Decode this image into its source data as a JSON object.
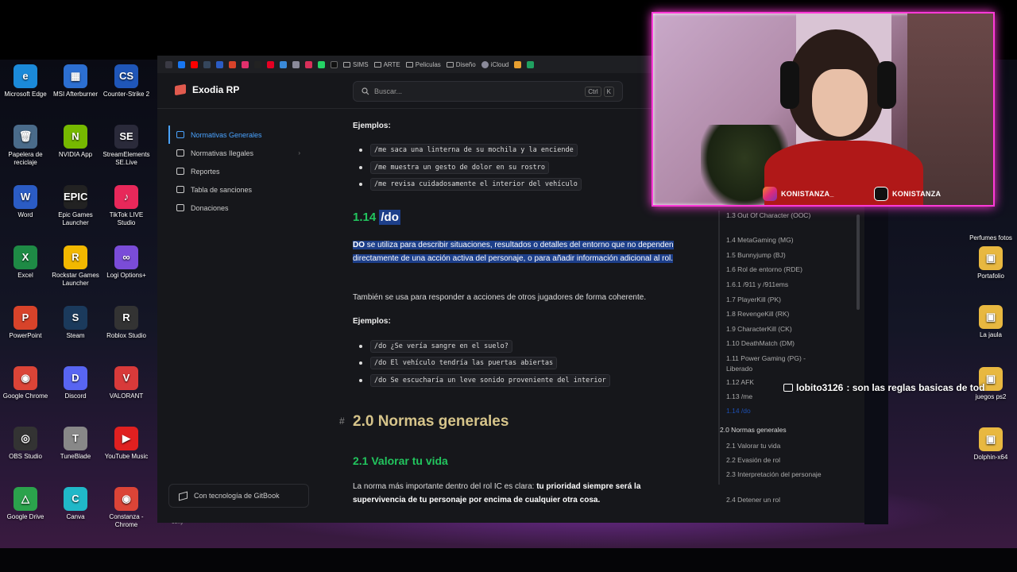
{
  "desktop": {
    "icons": [
      {
        "label": "Microsoft Edge",
        "color": "#1b8ad9",
        "glyph": "e"
      },
      {
        "label": "MSI Afterburner",
        "color": "#2c6fd1",
        "glyph": "▦"
      },
      {
        "label": "Counter-Strike 2",
        "color": "#1f56b8",
        "glyph": "CS"
      },
      {
        "label": "Papelera de reciclaje",
        "color": "#4a6b8a",
        "glyph": "🗑"
      },
      {
        "label": "NVIDIA App",
        "color": "#76b900",
        "glyph": "N"
      },
      {
        "label": "StreamElements SE.Live",
        "color": "#2a2a3a",
        "glyph": "SE"
      },
      {
        "label": "Word",
        "color": "#2b5cc4",
        "glyph": "W"
      },
      {
        "label": "Epic Games Launcher",
        "color": "#222",
        "glyph": "EPIC"
      },
      {
        "label": "TikTok LIVE Studio",
        "color": "#e8285a",
        "glyph": "♪"
      },
      {
        "label": "Excel",
        "color": "#1e8a45",
        "glyph": "X"
      },
      {
        "label": "Rockstar Games Launcher",
        "color": "#f2b800",
        "glyph": "R"
      },
      {
        "label": "Logi Options+",
        "color": "#7a4cd8",
        "glyph": "∞"
      },
      {
        "label": "PowerPoint",
        "color": "#d8432a",
        "glyph": "P"
      },
      {
        "label": "Steam",
        "color": "#1b3a5c",
        "glyph": "S"
      },
      {
        "label": "Roblox Studio",
        "color": "#333",
        "glyph": "R"
      },
      {
        "label": "Google Chrome",
        "color": "#db4437",
        "glyph": "◉"
      },
      {
        "label": "Discord",
        "color": "#5865f2",
        "glyph": "D"
      },
      {
        "label": "VALORANT",
        "color": "#d83a3a",
        "glyph": "V"
      },
      {
        "label": "OBS Studio",
        "color": "#333",
        "glyph": "◎"
      },
      {
        "label": "TuneBlade",
        "color": "#888",
        "glyph": "T"
      },
      {
        "label": "YouTube Music",
        "color": "#e02020",
        "glyph": "▶"
      },
      {
        "label": "Google Drive",
        "color": "#2ba24c",
        "glyph": "△"
      },
      {
        "label": "Canva",
        "color": "#20b8c8",
        "glyph": "C"
      },
      {
        "label": "Constanza - Chrome",
        "color": "#db4437",
        "glyph": "◉"
      }
    ],
    "right_icons": [
      {
        "label": "Perfumes fotos",
        "color": "#555",
        "glyph": ""
      },
      {
        "label": "Portafolio",
        "color": "#e8b840",
        "glyph": "▣"
      },
      {
        "label": "La jaula",
        "color": "#e8b840",
        "glyph": "▣"
      },
      {
        "label": "juegos ps2",
        "color": "#e8b840",
        "glyph": "▣"
      },
      {
        "label": "Dolphin-x64",
        "color": "#e8b840",
        "glyph": "▣"
      }
    ],
    "partial_labels": {
      "cony": "cony",
      "ac": "ac",
      "ec": "ec"
    }
  },
  "favbar": {
    "items": [
      "SIMS",
      "ARTE",
      "Peliculas",
      "Diseño",
      "iCloud"
    ]
  },
  "header": {
    "site_title": "Exodia RP",
    "search_placeholder": "Buscar...",
    "kbd1": "Ctrl",
    "kbd2": "K"
  },
  "sidebar": {
    "items": [
      {
        "label": "Normativas Generales",
        "active": true
      },
      {
        "label": "Normativas Ilegales",
        "active": false
      },
      {
        "label": "Reportes",
        "active": false
      },
      {
        "label": "Tabla de sanciones",
        "active": false
      },
      {
        "label": "Donaciones",
        "active": false
      }
    ],
    "footer": "Con tecnología de GitBook"
  },
  "content": {
    "ejemplos1": "Ejemplos:",
    "me_examples": [
      "/me saca una linterna de su mochila y la enciende",
      "/me muestra un gesto de dolor en su rostro",
      "/me revisa cuidadosamente el interior del vehículo"
    ],
    "sec114_num": "1.14",
    "sec114_cmd": "/do",
    "do_bold": "DO",
    "do_text": " se utiliza para describir situaciones, resultados o detalles del entorno que no dependen directamente de una acción activa del personaje, o para añadir información adicional al rol.",
    "also": "También se usa para responder a acciones de otros jugadores de forma coherente.",
    "ejemplos2": "Ejemplos:",
    "do_examples": [
      "/do ¿Se vería sangre en el suelo?",
      "/do El vehículo tendría las puertas abiertas",
      "/do Se escucharía un leve sonido proveniente del interior"
    ],
    "anchor": "#",
    "sec20": "2.0 Normas generales",
    "sec21": "2.1 Valorar tu vida",
    "p21_a": "La norma más importante dentro del rol IC es clara: ",
    "p21_b": "tu prioridad siempre será la supervivencia de tu personaje por encima de cualquier otra cosa."
  },
  "toc": {
    "items": [
      "1.3 Out Of Character (OOC)",
      "1.4 MetaGaming (MG)",
      "1.5 Bunnyjump (BJ)",
      "1.6 Rol de entorno (RDE)",
      "1.6.1 /911 y /911ems",
      "1.7 PlayerKill (PK)",
      "1.8 RevengeKill (RK)",
      "1.9 CharacterKill (CK)",
      "1.10 DeathMatch (DM)",
      "1.11 Power Gaming (PG) - Liberado",
      "1.12 AFK",
      "1.13 /me",
      "1.14 /do",
      "2.0 Normas generales",
      "2.1 Valorar tu vida",
      "2.2 Evasión de rol",
      "2.3 Interpretación del personaje",
      "2.4 Detener un rol"
    ],
    "active_index": 12
  },
  "overlay": {
    "instagram": "KONISTANZA_",
    "tiktok": "KONISTANZA",
    "chat_user": "lobito3126",
    "chat_msg": ": son las reglas basicas de tod"
  },
  "colors": {
    "accent": "#4aa3ff",
    "heading_green": "#22c55e",
    "heading_gold": "#d6c48a",
    "highlight": "#1d3f8a",
    "neon": "#ff3ad8"
  }
}
